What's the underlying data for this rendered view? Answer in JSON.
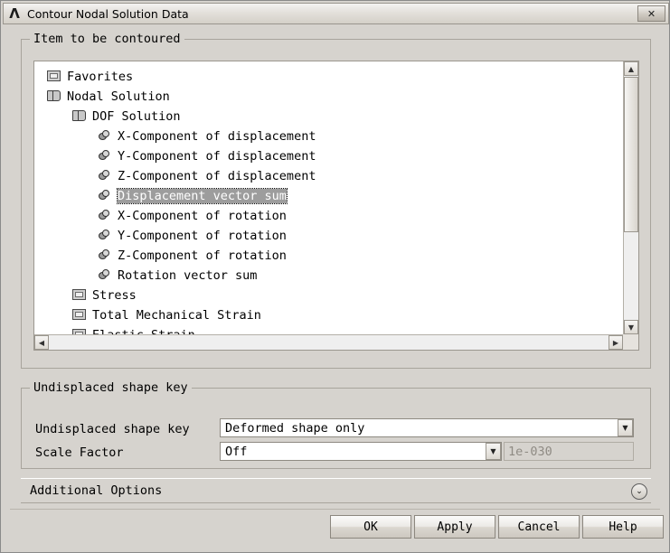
{
  "window": {
    "title": "Contour Nodal Solution Data",
    "logo_icon": "ansys-logo-icon",
    "close_label": "✕"
  },
  "item_group": {
    "legend": "Item to be contoured",
    "tree": [
      {
        "label": "Favorites",
        "indent": 0,
        "icon": "folder-icon",
        "selected": false
      },
      {
        "label": "Nodal Solution",
        "indent": 0,
        "icon": "book-icon",
        "selected": false
      },
      {
        "label": "DOF Solution",
        "indent": 1,
        "icon": "book-icon",
        "selected": false
      },
      {
        "label": "X-Component of displacement",
        "indent": 2,
        "icon": "cube-icon",
        "selected": false
      },
      {
        "label": "Y-Component of displacement",
        "indent": 2,
        "icon": "cube-icon",
        "selected": false
      },
      {
        "label": "Z-Component of displacement",
        "indent": 2,
        "icon": "cube-icon",
        "selected": false
      },
      {
        "label": "Displacement vector sum",
        "indent": 2,
        "icon": "cube-icon",
        "selected": true
      },
      {
        "label": "X-Component of rotation",
        "indent": 2,
        "icon": "cube-icon",
        "selected": false
      },
      {
        "label": "Y-Component of rotation",
        "indent": 2,
        "icon": "cube-icon",
        "selected": false
      },
      {
        "label": "Z-Component of rotation",
        "indent": 2,
        "icon": "cube-icon",
        "selected": false
      },
      {
        "label": "Rotation vector sum",
        "indent": 2,
        "icon": "cube-icon",
        "selected": false
      },
      {
        "label": "Stress",
        "indent": 1,
        "icon": "folder-icon",
        "selected": false
      },
      {
        "label": "Total Mechanical Strain",
        "indent": 1,
        "icon": "folder-icon",
        "selected": false
      },
      {
        "label": "Elastic Strain",
        "indent": 1,
        "icon": "folder-icon",
        "selected": false
      }
    ],
    "scroll": {
      "up_arrow": "▲",
      "down_arrow": "▼",
      "left_arrow": "◀",
      "right_arrow": "▶"
    }
  },
  "undisplaced_group": {
    "legend": "Undisplaced shape key",
    "shape_key_label": "Undisplaced shape key",
    "shape_key_value": "Deformed shape only",
    "scale_factor_label": "Scale Factor",
    "scale_factor_value": "Off",
    "scale_factor_number": "1e-030",
    "dropdown_arrow": "▼"
  },
  "additional_options": {
    "label": "Additional Options",
    "expander_icon": "chevron-down-circle-icon",
    "expander_glyph": "⌄"
  },
  "buttons": {
    "ok": "OK",
    "apply": "Apply",
    "cancel": "Cancel",
    "help": "Help"
  }
}
